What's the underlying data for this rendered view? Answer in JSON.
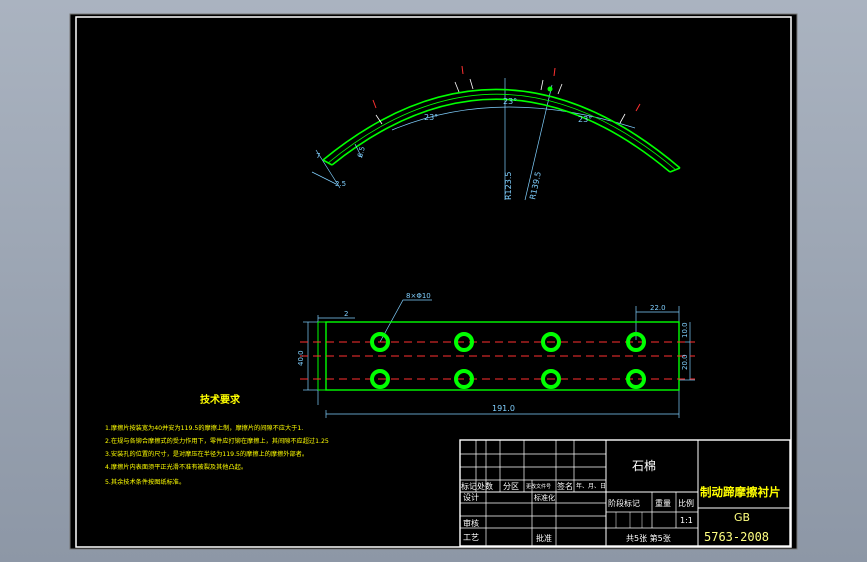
{
  "colors": {
    "background": "#000000",
    "frame": "#ffffff",
    "part": "#00ff00",
    "dimension": "#80d0ff",
    "centerline": "#ff3030",
    "note_text": "#ffff00",
    "title_text": "#ffff00",
    "title_highlight": "#ffff80",
    "outer_backdrop": "#9aa3b0"
  },
  "top_view": {
    "angle_left": "23°",
    "angle_middle": "23°",
    "angle_right": "23°",
    "radius_inner": "R123.5",
    "radius_outer": "R139.5",
    "dim_thickness": "6.5",
    "dim_small": "7",
    "dim_end": "2.5"
  },
  "front_view": {
    "hole_callout": "8×Φ10",
    "dim_left_gap": "2",
    "dim_height": "40.0",
    "dim_length": "191.0",
    "dim_edge": "22.0",
    "dim_top_offset": "10.0",
    "dim_hole_spacing": "20.0"
  },
  "tech_requirements": {
    "title": "技术要求",
    "items": [
      "1.摩擦片按装宽为40并安为119.5的摩擦上制，摩擦片的间隙不应大于1.",
      "2.在规与各铆合摩擦式的受力作用下，零件应打铆在摩擦上，其间隙不应超过1.25",
      "3.安装孔的位置的尺寸，是对摩压在半径为119.5的摩擦上的摩擦外部者。",
      "4.摩擦片内表面须平正光滑不准有被裂及其他凸起。",
      "5.其余技术条件按图纸标准。"
    ]
  },
  "title_block": {
    "material": "石棉",
    "part_name": "制动蹄摩擦衬片",
    "standard_line1": "GB",
    "standard_line2": "5763-2008",
    "rev_row": [
      "标记",
      "处数",
      "分区",
      "更改文件号",
      "签名",
      "年、月、日"
    ],
    "designer_label": "设计",
    "standardize_label": "标准化",
    "review_label": "审核",
    "process_label": "工艺",
    "approve_label": "批准",
    "stage_label": "阶段标记",
    "weight_label": "重量",
    "scale_label": "比例",
    "scale_value": "1:1",
    "sheet_info": "共5张  第5张"
  }
}
